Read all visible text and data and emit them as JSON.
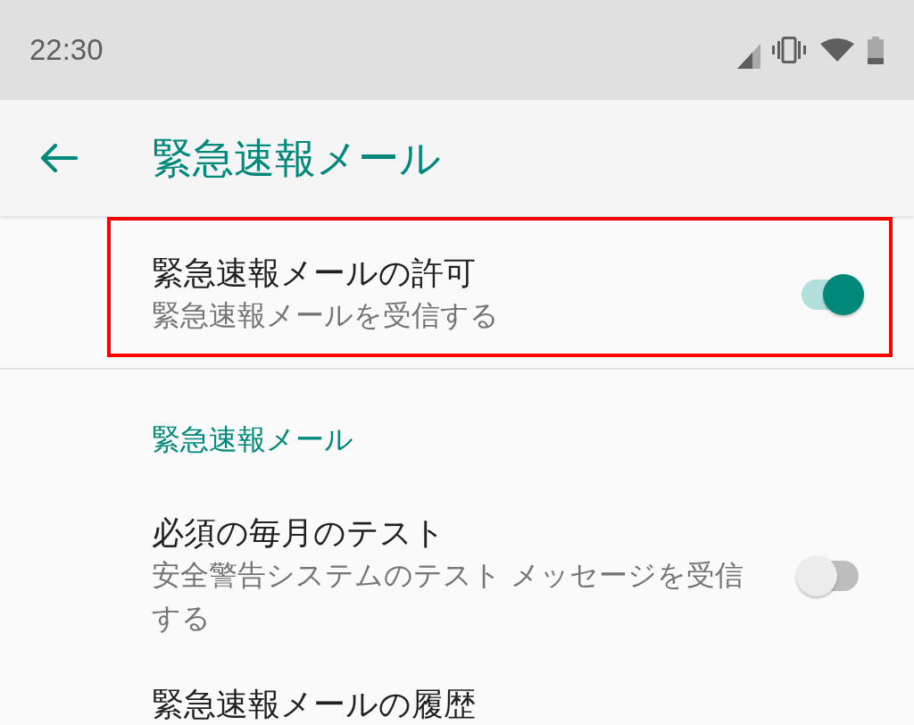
{
  "status_bar": {
    "time": "22:30"
  },
  "app_bar": {
    "title": "緊急速報メール"
  },
  "sections": [
    {
      "items": [
        {
          "kind": "switch",
          "title": "緊急速報メールの許可",
          "summary": "緊急速報メールを受信する",
          "on": true,
          "highlighted": true
        }
      ]
    },
    {
      "header": "緊急速報メール",
      "items": [
        {
          "kind": "switch",
          "title": "必須の毎月のテスト",
          "summary": "安全警告システムのテスト メッセージを受信する",
          "on": false,
          "highlighted": false
        },
        {
          "kind": "text",
          "title": "緊急速報メールの履歴",
          "highlighted": false
        }
      ]
    }
  ]
}
